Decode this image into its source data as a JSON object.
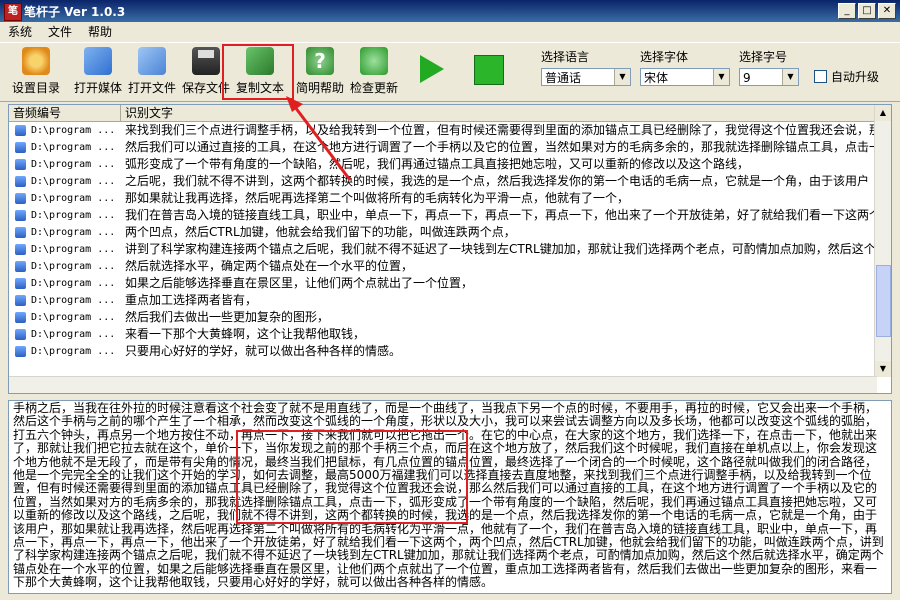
{
  "window": {
    "title": "笔杆子 Ver 1.0.3",
    "icon_text": "笔"
  },
  "menu": [
    "系统",
    "文件",
    "帮助"
  ],
  "toolbar": {
    "settings": "设置目录",
    "open_media": "打开媒体",
    "open_file": "打开文件",
    "save_file": "保存文件",
    "copy_text": "复制文本",
    "help": "简明帮助",
    "check_update": "检查更新"
  },
  "options": {
    "language_label": "选择语言",
    "language_value": "普通话",
    "font_label": "选择字体",
    "font_value": "宋体",
    "size_label": "选择字号",
    "size_value": "9",
    "auto_upgrade": "自动升级"
  },
  "list": {
    "columns": [
      "音频编号",
      "识别文字"
    ],
    "rows": [
      {
        "path": "D:\\program ...",
        "text": "来找到我们三个点进行调整手柄，以及给我转到一个位置，但有时候还需要得到里面的添加锚点工具已经删除了，我觉得这个位置我还会说，那么"
      },
      {
        "path": "D:\\program ...",
        "text": "然后我们可以通过直接的工具，在这个地方进行调置了一个手柄以及它的位置，当然如果对方的毛病多余的，那我就选择删除锚点工具，点击一下"
      },
      {
        "path": "D:\\program ...",
        "text": "弧形变成了一个带有角度的一个缺陷，然后呢，我们再通过锚点工具直接把她忘啦，又可以重新的修改以及这个路线，"
      },
      {
        "path": "D:\\program ...",
        "text": "之后呢，我们就不得不讲到，这两个都转换的时候，我选的是一个点，然后我选择发你的第一个电话的毛病一点，它就是一个角，由于该用户"
      },
      {
        "path": "D:\\program ...",
        "text": "那如果就让我再选择，然后呢再选择第二个叫做将所有的毛病转化为平滑一点，他就有了一个，"
      },
      {
        "path": "D:\\program ...",
        "text": "我们在普吉岛入境的链接直线工具，职业中，单点一下，再点一下，再点一下，再点一下，他出来了一个开放徒弟，好了就给我们看一下这两个"
      },
      {
        "path": "D:\\program ...",
        "text": "两个凹点，然后CTRL加键，他就会给我们留下的功能，叫做连跌两个点，"
      },
      {
        "path": "D:\\program ...",
        "text": "讲到了科学家构建连接两个锚点之后呢，我们就不得不延迟了一块钱到左CTRL键加加，那就让我们选择两个老点，可酌情加点加购，然后这个"
      },
      {
        "path": "D:\\program ...",
        "text": "然后就选择水平，确定两个锚点处在一个水平的位置，"
      },
      {
        "path": "D:\\program ...",
        "text": "如果之后能够选择垂直在景区里，让他们两个点就出了一个位置，"
      },
      {
        "path": "D:\\program ...",
        "text": "重点加工选择两者皆有，"
      },
      {
        "path": "D:\\program ...",
        "text": "然后我们去做出一些更加复杂的图形，"
      },
      {
        "path": "D:\\program ...",
        "text": "来看一下那个大黄蜂啊，这个让我帮他取钱，"
      },
      {
        "path": "D:\\program ...",
        "text": "只要用心好好的学好，就可以做出各种各样的情感。"
      }
    ]
  },
  "text_output": "手柄之后，当我在往外拉的时候注意看这个社会变了就不是用直线了，而是一个曲线了，当我点下另一个点的时候，不要用手，再拉的时候，它又会出来一个手柄，然后这个手柄与之前的哪个产生了一个相承，然而改变这个弧线的一个角度，形状以及大小，我可以来尝试去调整方向以及多长场，他都可以改变这个弧线的弧胎，打五六个钟头，再点另一个地方按住不动，再点一下，接下来我们就可以把它拖出一个。在它的中心点，在大家的这个地方，我们选择一下，在点击一下，他就出来了，那就让我们把它拉去就在这个，单价一下，当你发现之前的那个手柄三个点，而后在这个地方放了，然后我们这个时候呢，我们直接在单机点以上，你会发现这个地方他就不是无段了，而是带有尖角的情况，最终当我们把鼠标，有几点位置的锚点位置，最终选择了一个闭合的一个时候呢，这个路径就叫做我们的闭合路径，他是一个完完全全的让我们这个开始的学习，如何去调整，最高5000万福建我们可以选择直接去直度地整，来找到我们三个点进行调整手柄，以及给我转到一个位置，但有时候还需要得到里面的添加锚点工具已经删除了，我觉得这个位置我还会说，那么然后我们可以通过直接的工具，在这个地方进行调置了一个手柄以及它的位置，当然如果对方的毛病多余的，那我就选择删除锚点工具，点击一下，弧形变成了一个带有角度的一个缺陷，然后呢，我们再通过锚点工具直接把她忘啦，又可以重新的修改以及这个路线，之后呢，我们就不得不讲到，这两个都转换的时候，我选的是一个点，然后我选择发你的第一个电话的毛病一点，它就是一个角，由于该用户，那如果就让我再选择，然后呢再选择第二个叫做将所有的毛病转化为平滑一点，他就有了一个，我们在普吉岛入境的链接直线工具，职业中，单点一下，再点一下，再点一下，再点一下，他出来了一个开放徒弟，好了就给我们看一下这两个，两个凹点，然后CTRL加键，他就会给我们留下的功能，叫做连跌两个点，讲到了科学家构建连接两个锚点之后呢，我们就不得不延迟了一块钱到左CTRL键加加，那就让我们选择两个老点，可酌情加点加购，然后这个然后就选择水平，确定两个锚点处在一个水平的位置，如果之后能够选择垂直在景区里，让他们两个点就出了一个位置，重点加工选择两者皆有，然后我们去做出一些更加复杂的图形，来看一下那个大黄蜂啊，这个让我帮他取钱，只要用心好好的学好，就可以做出各种各样的情感。"
}
